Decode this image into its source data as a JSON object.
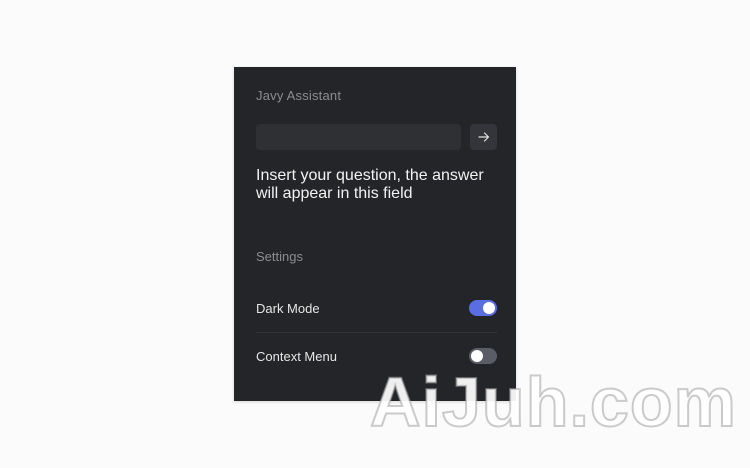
{
  "assistant": {
    "title": "Javy Assistant",
    "input_value": "",
    "send_icon": "arrow-right-icon",
    "answer_text": "Insert your question, the answer will appear in this field"
  },
  "settings": {
    "heading": "Settings",
    "items": [
      {
        "label": "Dark Mode",
        "enabled": true
      },
      {
        "label": "Context Menu",
        "enabled": false
      }
    ]
  },
  "colors": {
    "panel_bg": "#242528",
    "toggle_on": "#5b6ee1",
    "toggle_off": "#5a5d66"
  },
  "watermark": "AiJuh.com"
}
